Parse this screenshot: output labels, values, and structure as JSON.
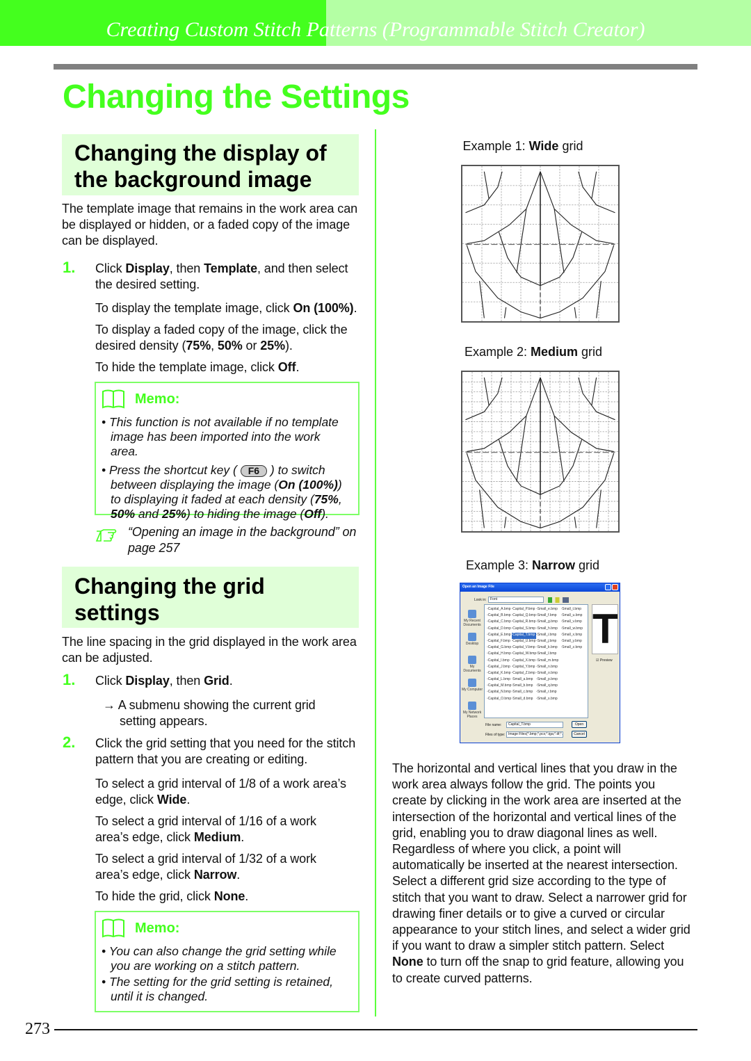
{
  "header": {
    "chapter": "Creating Custom Stitch Patterns (Programmable Stitch Creator)",
    "title": "Changing the Settings"
  },
  "colors": {
    "accent": "#44ff1e",
    "band_light": "#b4ffa4",
    "heading_bg": "#e0ffd8",
    "memo_border": "#7dff66"
  },
  "section1": {
    "heading": "Changing the display of the background image",
    "intro": "The template image that remains in the work area can be displayed or hidden, or a faded copy of the image can be displayed.",
    "step1": {
      "num": "1.",
      "text": [
        [
          "Click ",
          0
        ],
        [
          "Display",
          1
        ],
        [
          ", then ",
          0
        ],
        [
          "Template",
          1
        ],
        [
          ", and then select the desired setting.",
          0
        ]
      ]
    },
    "sub": [
      [
        [
          "To display the template image, click ",
          0
        ],
        [
          "On (100%)",
          1
        ],
        [
          ".",
          0
        ]
      ],
      [
        [
          "To display a faded copy of the image, click the desired density (",
          0
        ],
        [
          "75%",
          1
        ],
        [
          ", ",
          0
        ],
        [
          "50%",
          1
        ],
        [
          " or ",
          0
        ],
        [
          "25%",
          1
        ],
        [
          ").",
          0
        ]
      ],
      [
        [
          "To hide the template image, click ",
          0
        ],
        [
          "Off",
          1
        ],
        [
          ".",
          0
        ]
      ]
    ],
    "memo": {
      "title": "Memo:",
      "icon": "book-icon",
      "item1": "This function is not available if no template image has been imported into the work area.",
      "item2a": "Press the shortcut key ( ",
      "key": "F6",
      "item2b": [
        [
          " ) to switch between displaying the image (",
          0
        ],
        [
          "On (100%)",
          1
        ],
        [
          ") to displaying it faded at each density (",
          0
        ],
        [
          "75%",
          1
        ],
        [
          ", ",
          0
        ],
        [
          "50%",
          1
        ],
        [
          " and ",
          0
        ],
        [
          "25%",
          1
        ],
        [
          ") to hiding the image (",
          0
        ],
        [
          "Off",
          1
        ],
        [
          ").",
          0
        ]
      ]
    },
    "reference": {
      "icon": "pointing-hand-icon",
      "text": "“Opening an image in the background” on page 257"
    }
  },
  "section2": {
    "heading": "Changing the grid settings",
    "intro": "The line spacing in the grid displayed in the work area can be adjusted.",
    "step1": {
      "num": "1.",
      "text": [
        [
          "Click ",
          0
        ],
        [
          "Display",
          1
        ],
        [
          ", then ",
          0
        ],
        [
          "Grid",
          1
        ],
        [
          ".",
          0
        ]
      ]
    },
    "result": "→ A submenu showing the current grid setting appears.",
    "step2": {
      "num": "2.",
      "text": [
        [
          "Click the grid setting that you need for the stitch pattern that you are creating or editing.",
          0
        ]
      ]
    },
    "sub": [
      [
        [
          "To select a grid interval of 1/8 of a work area’s edge, click ",
          0
        ],
        [
          "Wide",
          1
        ],
        [
          ".",
          0
        ]
      ],
      [
        [
          "To select a grid interval of 1/16 of a work area’s edge, click ",
          0
        ],
        [
          "Medium",
          1
        ],
        [
          ".",
          0
        ]
      ],
      [
        [
          "To select a grid interval of 1/32 of a work area’s edge, click ",
          0
        ],
        [
          "Narrow",
          1
        ],
        [
          ".",
          0
        ]
      ],
      [
        [
          "To hide the grid, click ",
          0
        ],
        [
          "None",
          1
        ],
        [
          ".",
          0
        ]
      ]
    ],
    "memo": {
      "title": "Memo:",
      "icon": "book-icon",
      "item1": "You can also change the grid setting while you are working on a stitch pattern.",
      "item2": "The setting for the grid setting is retained, until it is changed."
    }
  },
  "examples": [
    {
      "label": [
        [
          "Example 1: ",
          0
        ],
        [
          "Wide",
          1
        ],
        [
          " grid",
          0
        ]
      ],
      "divisions": 8
    },
    {
      "label": [
        [
          "Example 2: ",
          0
        ],
        [
          "Medium",
          1
        ],
        [
          " grid",
          0
        ]
      ],
      "divisions": 16
    },
    {
      "label": [
        [
          "Example 3: ",
          0
        ],
        [
          "Narrow",
          1
        ],
        [
          " grid",
          0
        ]
      ]
    }
  ],
  "dialog": {
    "title": "Open an Image File",
    "look_in_label": "Look in:",
    "look_in": "Font",
    "places": [
      "My Recent Documents",
      "Desktop",
      "My Documents",
      "My Computer",
      "My Network Places"
    ],
    "files": [
      "Capital_A.bmp",
      "Capital_B.bmp",
      "Capital_C.bmp",
      "Capital_D.bmp",
      "Capital_E.bmp",
      "Capital_F.bmp",
      "Capital_G.bmp",
      "Capital_H.bmp",
      "Capital_I.bmp",
      "Capital_J.bmp",
      "Capital_K.bmp",
      "Capital_L.bmp",
      "Capital_M.bmp",
      "Capital_N.bmp",
      "Capital_O.bmp",
      "Capital_P.bmp",
      "Capital_Q.bmp",
      "Capital_R.bmp",
      "Capital_S.bmp",
      "Capital_T.bmp",
      "Capital_U.bmp",
      "Capital_V.bmp",
      "Capital_W.bmp",
      "Capital_X.bmp",
      "Capital_Y.bmp",
      "Capital_Z.bmp",
      "Small_a.bmp",
      "Small_b.bmp",
      "Small_c.bmp",
      "Small_d.bmp",
      "Small_e.bmp",
      "Small_f.bmp",
      "Small_g.bmp",
      "Small_h.bmp",
      "Small_i.bmp",
      "Small_j.bmp",
      "Small_k.bmp",
      "Small_l.bmp",
      "Small_m.bmp",
      "Small_n.bmp",
      "Small_o.bmp",
      "Small_p.bmp",
      "Small_q.bmp",
      "Small_r.bmp",
      "Small_s.bmp",
      "Small_t.bmp",
      "Small_u.bmp",
      "Small_v.bmp",
      "Small_w.bmp",
      "Small_x.bmp",
      "Small_y.bmp",
      "Small_z.bmp"
    ],
    "selected": "Capital_T.bmp",
    "preview_glyph": "T",
    "preview_label": "Preview",
    "filename_label": "File name:",
    "filename": "Capital_T.bmp",
    "filetype_label": "Files of type:",
    "filetype": "Image Files(*.bmp;*.pcx;*.tga;*.tif;*.jpg;*.pcx;*.w",
    "open": "Open",
    "cancel": "Cancel"
  },
  "right_text": [
    [
      "The horizontal and vertical lines that you draw in the work area always follow the grid. The points you create by clicking in the work area are inserted at the intersection of the horizontal and vertical lines of the grid, enabling you to draw diagonal lines as well. Regardless of where you click, a point will automatically be inserted at the nearest intersection. Select a different grid size according to the type of stitch that you want to draw. Select a narrower grid for drawing finer details or to give a curved or circular appearance to your stitch lines, and select a wider grid if you want to draw a simpler stitch pattern. Select ",
      0
    ],
    [
      "None",
      1
    ],
    [
      " to turn off the snap to grid feature, allowing you to create curved patterns.",
      0
    ]
  ],
  "page_number": "273"
}
